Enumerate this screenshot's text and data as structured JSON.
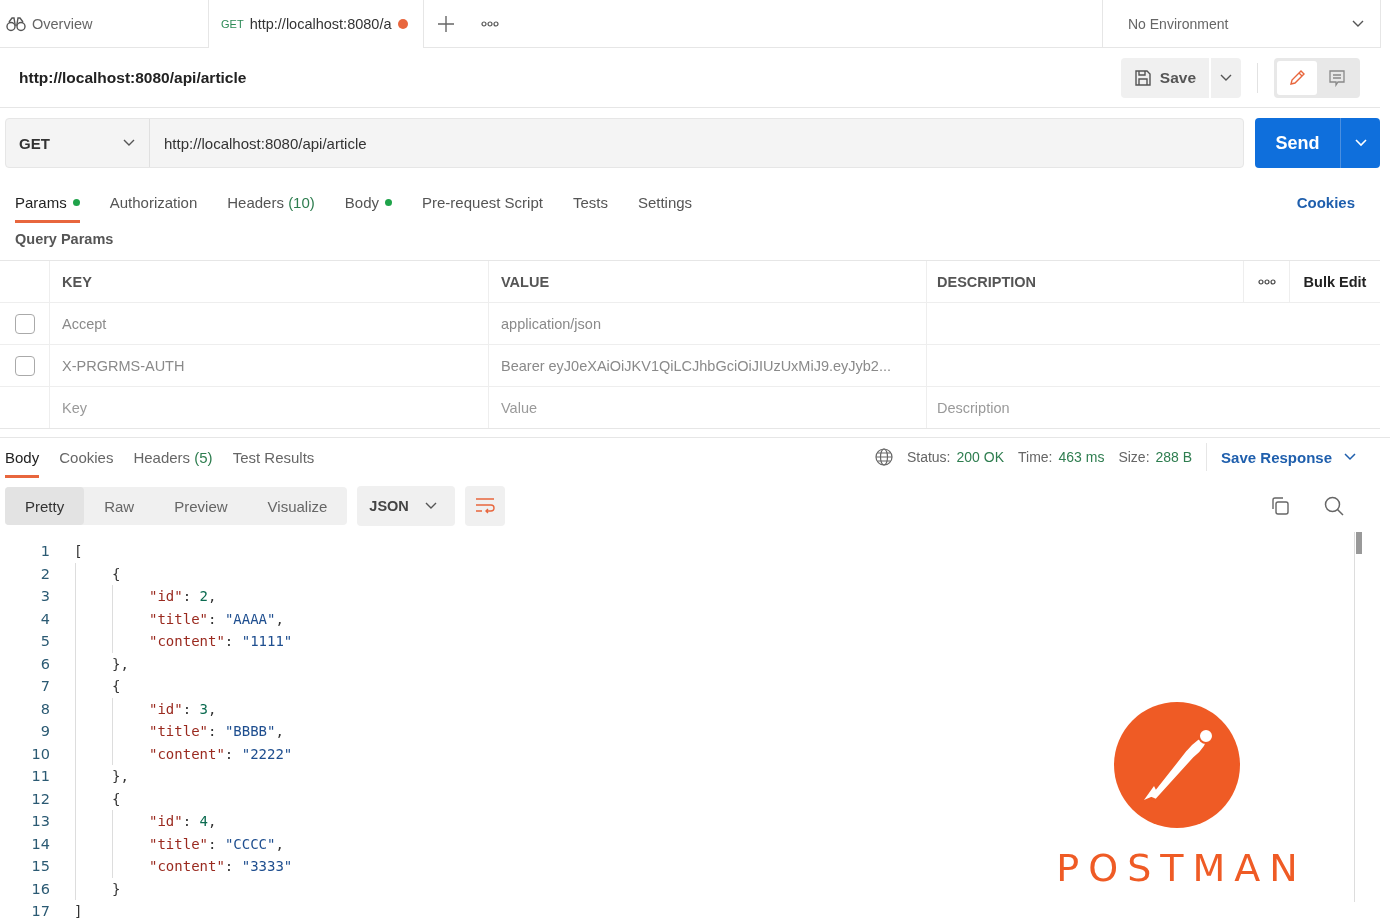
{
  "tabs": [
    {
      "kind": "overview",
      "label": "Overview",
      "selected": false
    },
    {
      "kind": "request",
      "method": "GET",
      "label": "http://localhost:8080/a",
      "unsaved": true,
      "selected": true
    }
  ],
  "environment": {
    "label": "No Environment"
  },
  "edit_modes": [
    {
      "kind": "edit",
      "selected": true
    },
    {
      "kind": "comments",
      "selected": false
    }
  ],
  "request": {
    "title": "http://localhost:8080/api/article",
    "save_label": "Save",
    "method": "GET",
    "url": "http://localhost:8080/api/article",
    "send_label": "Send"
  },
  "request_tabs": [
    {
      "label": "Params",
      "dot": true,
      "selected": true
    },
    {
      "label": "Authorization",
      "dot": false,
      "selected": false
    },
    {
      "label": "Headers",
      "count": "(10)",
      "dot": false,
      "selected": false
    },
    {
      "label": "Body",
      "dot": true,
      "selected": false
    },
    {
      "label": "Pre-request Script",
      "dot": false,
      "selected": false
    },
    {
      "label": "Tests",
      "dot": false,
      "selected": false
    },
    {
      "label": "Settings",
      "dot": false,
      "selected": false
    }
  ],
  "cookies_link": "Cookies",
  "section_title": "Query Params",
  "params_table": {
    "columns": [
      "KEY",
      "VALUE",
      "DESCRIPTION"
    ],
    "bulk_edit": "Bulk Edit",
    "rows": [
      {
        "checked": false,
        "key": "Accept",
        "value": "application/json",
        "description": ""
      },
      {
        "checked": false,
        "key": "X-PRGRMS-AUTH",
        "value": "Bearer eyJ0eXAiOiJKV1QiLCJhbGciOiJIUzUxMiJ9.eyJyb2...",
        "description": ""
      }
    ],
    "placeholders": {
      "key": "Key",
      "value": "Value",
      "description": "Description"
    }
  },
  "response_tabs": [
    {
      "label": "Body",
      "selected": true
    },
    {
      "label": "Cookies",
      "selected": false
    },
    {
      "label": "Headers",
      "count": "(5)",
      "selected": false
    },
    {
      "label": "Test Results",
      "selected": false
    }
  ],
  "response_stats": [
    {
      "label": "Status:",
      "value": "200 OK"
    },
    {
      "label": "Time:",
      "value": "463 ms"
    },
    {
      "label": "Size:",
      "value": "288 B"
    }
  ],
  "save_response": "Save Response",
  "view_modes": [
    {
      "label": "Pretty",
      "selected": true
    },
    {
      "label": "Raw",
      "selected": false
    },
    {
      "label": "Preview",
      "selected": false
    },
    {
      "label": "Visualize",
      "selected": false
    }
  ],
  "format": "JSON",
  "code_lines": [
    {
      "number": "1",
      "tokens": [
        {
          "kind": "open",
          "text": "["
        }
      ]
    },
    {
      "number": "2",
      "tokens": [
        {
          "kind": "open",
          "text": "{"
        }
      ]
    },
    {
      "number": "3",
      "tokens": [
        {
          "kind": "key",
          "text": "\"id\""
        },
        {
          "kind": "punct",
          "text": ": "
        },
        {
          "kind": "num",
          "text": "2"
        },
        {
          "kind": "punct",
          "text": ","
        }
      ]
    },
    {
      "number": "4",
      "tokens": [
        {
          "kind": "key",
          "text": "\"title\""
        },
        {
          "kind": "punct",
          "text": ": "
        },
        {
          "kind": "str",
          "text": "\"AAAA\""
        },
        {
          "kind": "punct",
          "text": ","
        }
      ]
    },
    {
      "number": "5",
      "tokens": [
        {
          "kind": "key",
          "text": "\"content\""
        },
        {
          "kind": "punct",
          "text": ": "
        },
        {
          "kind": "str",
          "text": "\"1111\""
        }
      ]
    },
    {
      "number": "6",
      "tokens": [
        {
          "kind": "close",
          "text": "},"
        }
      ]
    },
    {
      "number": "7",
      "tokens": [
        {
          "kind": "open",
          "text": "{"
        }
      ]
    },
    {
      "number": "8",
      "tokens": [
        {
          "kind": "key",
          "text": "\"id\""
        },
        {
          "kind": "punct",
          "text": ": "
        },
        {
          "kind": "num",
          "text": "3"
        },
        {
          "kind": "punct",
          "text": ","
        }
      ]
    },
    {
      "number": "9",
      "tokens": [
        {
          "kind": "key",
          "text": "\"title\""
        },
        {
          "kind": "punct",
          "text": ": "
        },
        {
          "kind": "str",
          "text": "\"BBBB\""
        },
        {
          "kind": "punct",
          "text": ","
        }
      ]
    },
    {
      "number": "10",
      "tokens": [
        {
          "kind": "key",
          "text": "\"content\""
        },
        {
          "kind": "punct",
          "text": ": "
        },
        {
          "kind": "str",
          "text": "\"2222\""
        }
      ]
    },
    {
      "number": "11",
      "tokens": [
        {
          "kind": "close",
          "text": "},"
        }
      ]
    },
    {
      "number": "12",
      "tokens": [
        {
          "kind": "open",
          "text": "{"
        }
      ]
    },
    {
      "number": "13",
      "tokens": [
        {
          "kind": "key",
          "text": "\"id\""
        },
        {
          "kind": "punct",
          "text": ": "
        },
        {
          "kind": "num",
          "text": "4"
        },
        {
          "kind": "punct",
          "text": ","
        }
      ]
    },
    {
      "number": "14",
      "tokens": [
        {
          "kind": "key",
          "text": "\"title\""
        },
        {
          "kind": "punct",
          "text": ": "
        },
        {
          "kind": "str",
          "text": "\"CCCC\""
        },
        {
          "kind": "punct",
          "text": ","
        }
      ]
    },
    {
      "number": "15",
      "tokens": [
        {
          "kind": "key",
          "text": "\"content\""
        },
        {
          "kind": "punct",
          "text": ": "
        },
        {
          "kind": "str",
          "text": "\"3333\""
        }
      ]
    },
    {
      "number": "16",
      "tokens": [
        {
          "kind": "close",
          "text": "}"
        }
      ]
    },
    {
      "number": "17",
      "tokens": [
        {
          "kind": "close",
          "text": "]"
        }
      ]
    }
  ],
  "logo": {
    "text": "POSTMAN"
  }
}
